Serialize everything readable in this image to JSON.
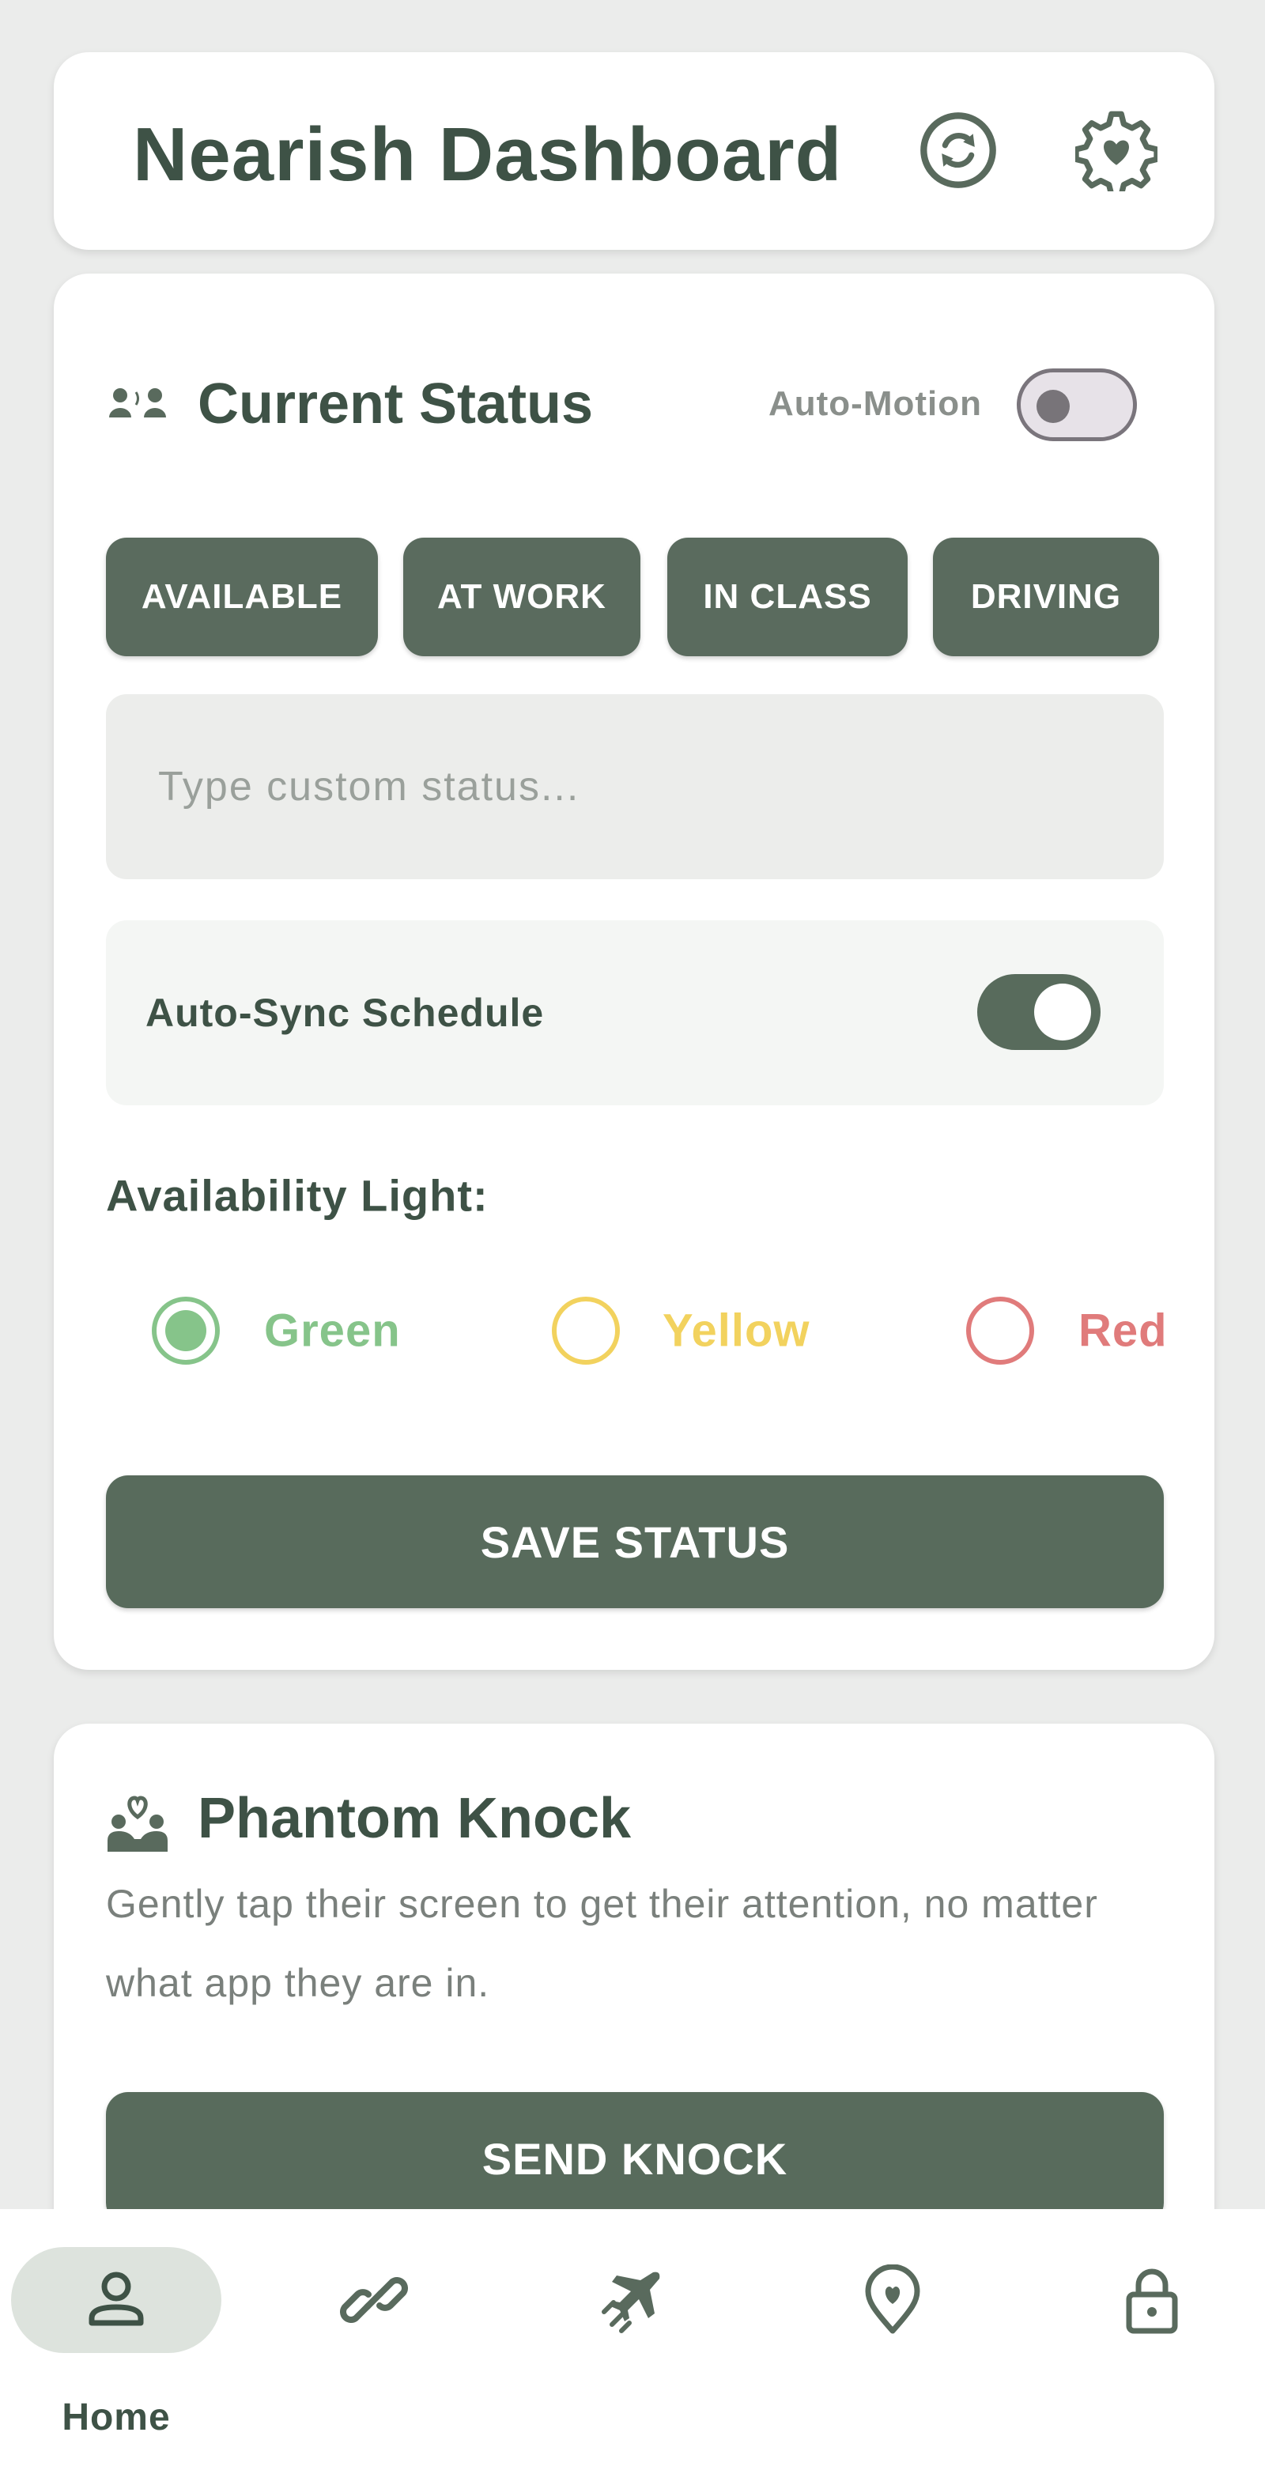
{
  "header": {
    "title": "Nearish Dashboard",
    "icons": [
      "sync-icon",
      "gear-heart-icon"
    ]
  },
  "status_card": {
    "title": "Current Status",
    "auto_motion_label": "Auto-Motion",
    "auto_motion_on": false,
    "chips": [
      "AVAILABLE",
      "AT WORK",
      "IN CLASS",
      "DRIVING"
    ],
    "custom_status": {
      "value": "",
      "placeholder": "Type custom status..."
    },
    "auto_sync_label": "Auto-Sync Schedule",
    "auto_sync_on": true,
    "availability_label": "Availability Light:",
    "availability_options": [
      {
        "label": "Green",
        "color": "#86c48a",
        "selected": true
      },
      {
        "label": "Yellow",
        "color": "#f2d25e",
        "selected": false
      },
      {
        "label": "Red",
        "color": "#e07b7b",
        "selected": false
      }
    ],
    "save_label": "SAVE STATUS"
  },
  "knock_card": {
    "title": "Phantom Knock",
    "description": "Gently tap their screen to get their attention, no matter what app they are in.",
    "button_label": "SEND KNOCK"
  },
  "bottom_nav": {
    "items": [
      {
        "label": "Home",
        "icon": "person-icon",
        "active": true
      },
      {
        "label": "",
        "icon": "link-icon",
        "active": false
      },
      {
        "label": "",
        "icon": "airplane-icon",
        "active": false
      },
      {
        "label": "",
        "icon": "location-heart-icon",
        "active": false
      },
      {
        "label": "",
        "icon": "lock-icon",
        "active": false
      }
    ]
  },
  "colors": {
    "background": "#ebeceb",
    "primary": "#586b5c",
    "text_dark": "#3e5246",
    "green": "#86c48a",
    "yellow": "#f2d25e",
    "red": "#e07b7b"
  }
}
